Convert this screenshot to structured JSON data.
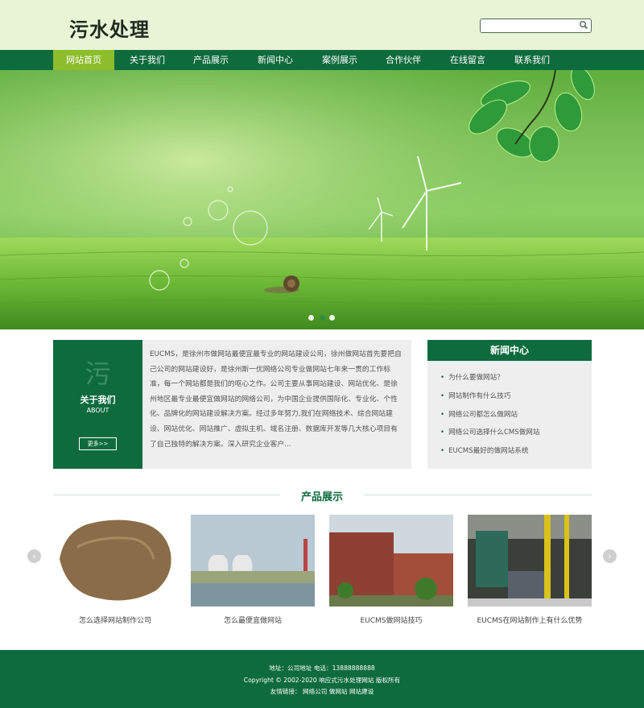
{
  "site": {
    "logo": "污水处理"
  },
  "search": {
    "placeholder": ""
  },
  "nav": [
    "网站首页",
    "关于我们",
    "产品展示",
    "新闻中心",
    "案例展示",
    "合作伙伴",
    "在线留言",
    "联系我们"
  ],
  "banner": {
    "slide_count": 3,
    "active_slide": 3
  },
  "about": {
    "char": "污",
    "title": "关于我们",
    "subtitle": "ABOUT",
    "more": "更多>>",
    "text": "EUCMS，是徐州市做网站最便宜最专业的网站建设公司，徐州做网站首先要把自己公司的网站建设好，是徐州斯一优网络公司专业做网站七年来一贯的工作标准，每一个网站都是我们的呕心之作。公司主要从事网站建设、网站优化、是徐州地区最专业最便宜做网站的网络公司，为中国企业提供国际化、专业化、个性化、品牌化的网站建设解决方案。经过多年努力,我们在网络技术、综合网站建设、网站优化、网站推广、虚拟主机、域名注册、数据库开发等几大核心项目有了自己独特的解决方案。深入研究企业客户..."
  },
  "news": {
    "title": "新闻中心",
    "items": [
      "为什么要做网站？",
      "网站制作有什么技巧",
      "网络公司都怎么做网站",
      "网络公司选择什么CMS做网站",
      "EUCMS最好的做网站系统"
    ]
  },
  "products": {
    "title": "产品展示",
    "prev": "‹",
    "next": "›",
    "items": [
      "怎么选择网站制作公司",
      "怎么最便宜做网站",
      "EUCMS做网站技巧",
      "EUCMS在网站制作上有什么优势"
    ]
  },
  "footer": {
    "line1": "地址：公司地址  电话：13888888888",
    "line2": "Copyright © 2002-2020 响应式污水处理网站 版权所有",
    "line3": "友情链接：  网络公司 做网站 网站建设"
  },
  "colors": {
    "primary": "#0e6b3d",
    "accent": "#8dbd2b",
    "header_bg": "#e9f3d6"
  }
}
